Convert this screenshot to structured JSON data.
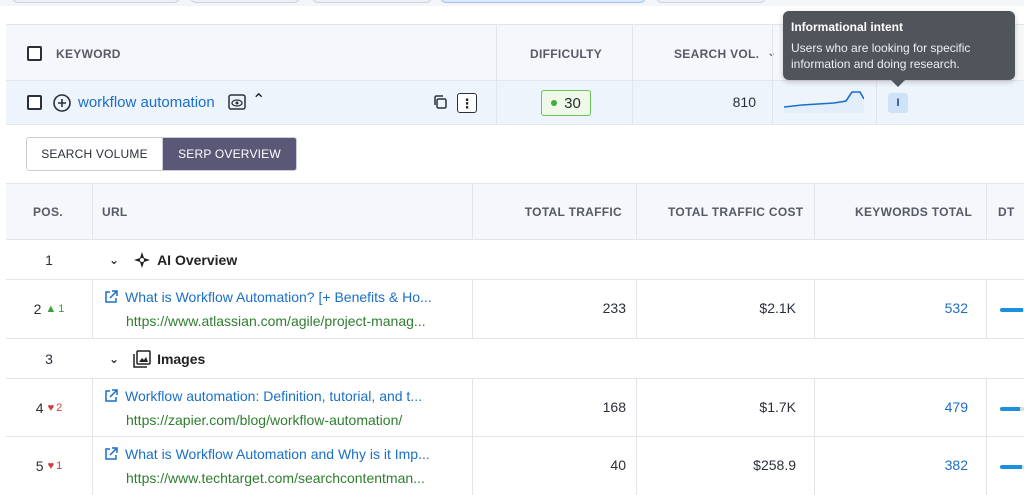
{
  "keyword_table": {
    "headers": {
      "keyword": "KEYWORD",
      "difficulty": "DIFFICULTY",
      "search_volume": "SEARCH VOL."
    },
    "row": {
      "keyword": "workflow automation",
      "difficulty": "30",
      "search_volume": "810",
      "intent": "I",
      "trend_icon": "sparkline-icon"
    }
  },
  "tooltip": {
    "title": "Informational intent",
    "body": "Users who are looking for specific information and doing research."
  },
  "tabs": [
    {
      "label": "SEARCH VOLUME",
      "active": false
    },
    {
      "label": "SERP OVERVIEW",
      "active": true
    }
  ],
  "serp_table": {
    "headers": {
      "pos": "POS.",
      "url": "URL",
      "total_traffic": "TOTAL TRAFFIC",
      "total_traffic_cost": "TOTAL TRAFFIC COST",
      "keywords_total": "KEYWORDS TOTAL",
      "dt": "DT"
    },
    "rows": [
      {
        "type": "feature",
        "pos": "1",
        "label": "AI Overview",
        "icon": "ai-overview-icon"
      },
      {
        "type": "url",
        "pos": "2",
        "change": "1",
        "change_dir": "up",
        "title": "What is Workflow Automation? [+ Benefits & Ho...",
        "url": "https://www.atlassian.com/agile/project-manag...",
        "total_traffic": "233",
        "total_traffic_cost": "$2.1K",
        "keywords_total": "532",
        "dt_level": 0.95
      },
      {
        "type": "feature",
        "pos": "3",
        "label": "Images",
        "icon": "images-icon"
      },
      {
        "type": "url",
        "pos": "4",
        "change": "2",
        "change_dir": "down",
        "title": "Workflow automation: Definition, tutorial, and t...",
        "url": "https://zapier.com/blog/workflow-automation/",
        "total_traffic": "168",
        "total_traffic_cost": "$1.7K",
        "keywords_total": "479",
        "dt_level": 0.85
      },
      {
        "type": "url",
        "pos": "5",
        "change": "1",
        "change_dir": "down",
        "title": "What is Workflow Automation and Why is it Imp...",
        "url": "https://www.techtarget.com/searchcontentman...",
        "total_traffic": "40",
        "total_traffic_cost": "$258.9",
        "keywords_total": "382",
        "dt_level": 0.9
      }
    ]
  },
  "colors": {
    "link_blue": "#1a6fc9",
    "url_green": "#2f7d2f",
    "active_tab": "#5b5877",
    "difficulty_green": "#3fae36",
    "up_green": "#3a9f3a",
    "down_red": "#d23c3c"
  }
}
